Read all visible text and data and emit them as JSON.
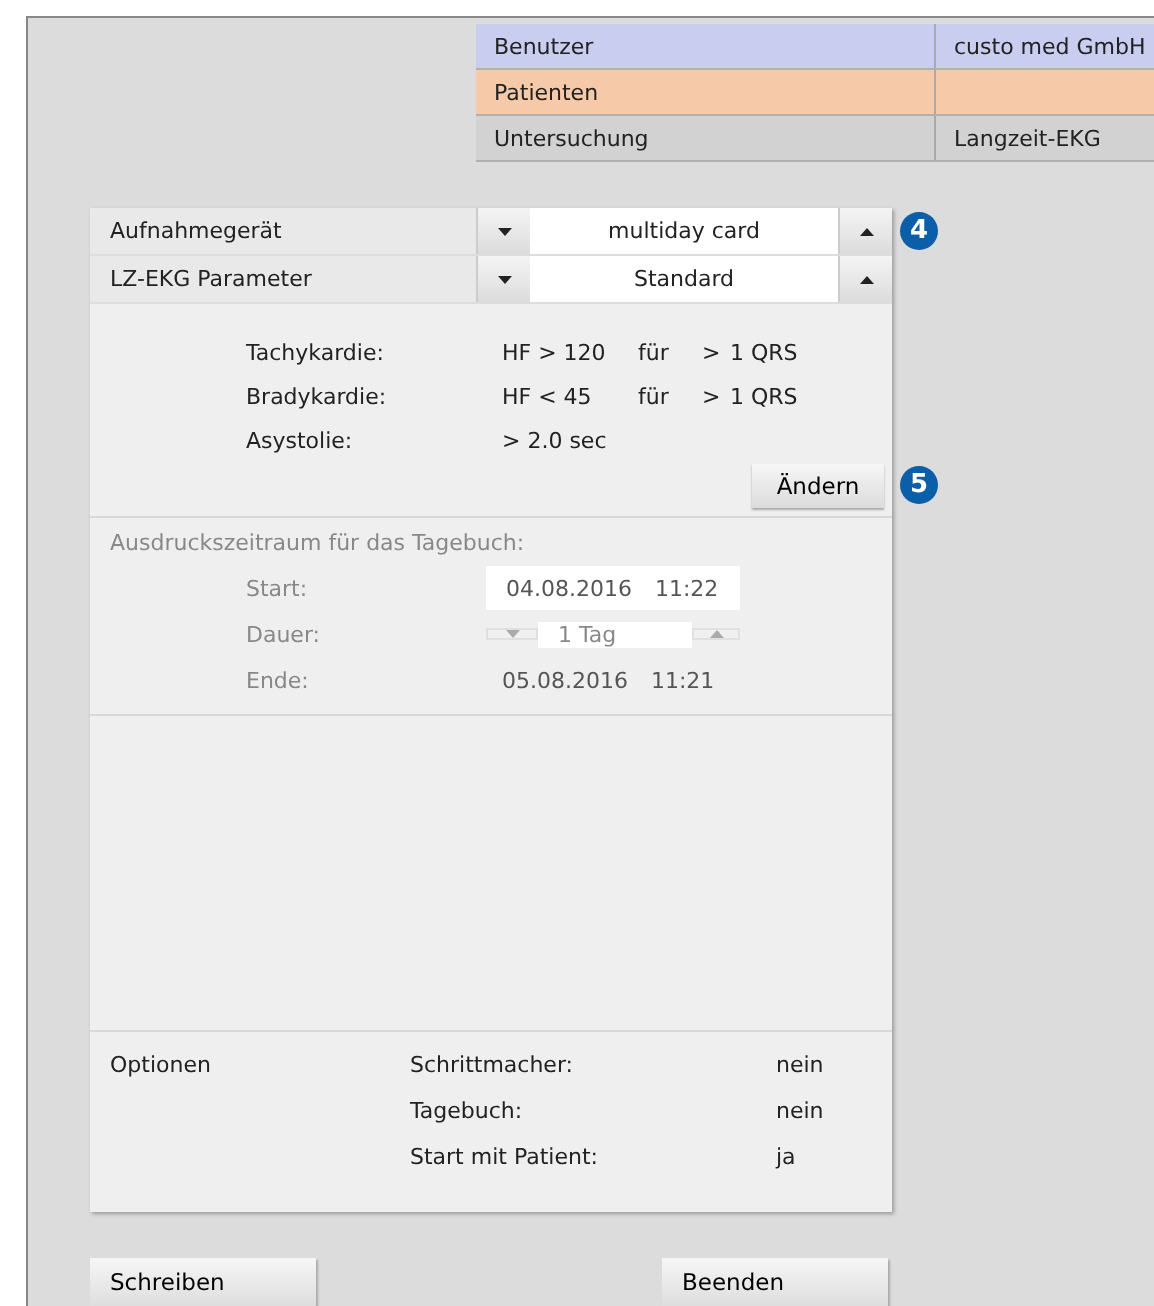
{
  "header": {
    "rows": [
      {
        "label": "Benutzer",
        "value": "custo med GmbH",
        "color": "#c9cdf0"
      },
      {
        "label": "Patienten",
        "color": "#f6c9a8"
      },
      {
        "label": "Untersuchung",
        "value": "Langzeit-EKG",
        "color": "#d2d2d2"
      }
    ]
  },
  "selectors": [
    {
      "label": "Aufnahmegerät",
      "value": "multiday card",
      "callout": "4"
    },
    {
      "label": "LZ-EKG Parameter",
      "value": "Standard"
    }
  ],
  "parameters": [
    {
      "label": "Tachykardie:",
      "condition": "HF > 120",
      "for": "für",
      "op": ">",
      "count": "1 QRS"
    },
    {
      "label": "Bradykardie:",
      "condition": "HF < 45",
      "for": "für",
      "op": ">",
      "count": "1 QRS"
    },
    {
      "label": "Asystolie:",
      "condition": "> 2.0 sec"
    }
  ],
  "change_button": {
    "label": "Ändern",
    "callout": "5"
  },
  "print_period": {
    "title": "Ausdruckszeitraum für das Tagebuch:",
    "disabled": true,
    "start": {
      "label": "Start:",
      "value": "04.08.2016 11:22"
    },
    "duration": {
      "label": "Dauer:",
      "value": "1 Tag"
    },
    "end": {
      "label": "Ende:",
      "value": "05.08.2016 11:21"
    }
  },
  "options": {
    "title": "Optionen",
    "items": [
      {
        "label": "Schrittmacher:",
        "value": "nein"
      },
      {
        "label": "Tagebuch:",
        "value": "nein"
      },
      {
        "label": "Start mit Patient:",
        "value": "ja"
      }
    ]
  },
  "buttons": [
    {
      "label": "Schreiben"
    },
    {
      "label": "Beenden"
    }
  ]
}
